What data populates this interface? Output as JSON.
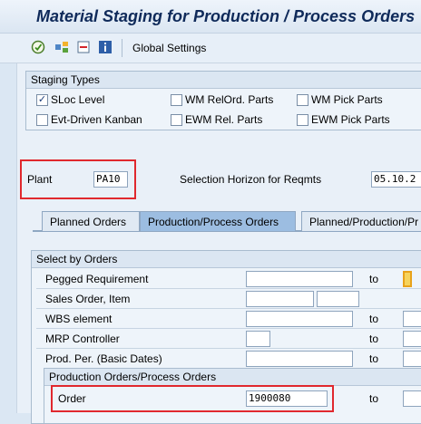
{
  "window": {
    "title": "Material Staging for Production / Process Orders"
  },
  "toolbar": {
    "icons": [
      "execute-icon",
      "variant-icon",
      "delete-icon",
      "info-icon"
    ],
    "global_settings_label": "Global Settings"
  },
  "staging_types": {
    "title": "Staging Types",
    "items": [
      {
        "label": "SLoc Level",
        "checked": true
      },
      {
        "label": "Evt-Driven Kanban",
        "checked": false
      },
      {
        "label": "WM RelOrd. Parts",
        "checked": false
      },
      {
        "label": "EWM Rel. Parts",
        "checked": false
      },
      {
        "label": "WM Pick Parts",
        "checked": false
      },
      {
        "label": "EWM Pick Parts",
        "checked": false
      }
    ]
  },
  "plant": {
    "label": "Plant",
    "value": "PA10"
  },
  "selection_horizon": {
    "label": "Selection Horizon for Reqmts",
    "value": "05.10.2"
  },
  "tabs": [
    "Planned Orders",
    "Production/Process Orders",
    "Planned/Production/Pr"
  ],
  "select_by_orders": {
    "title": "Select by Orders",
    "rows": [
      {
        "label": "Pegged Requirement",
        "to": "to"
      },
      {
        "label": "Sales Order, Item",
        "to": ""
      },
      {
        "label": "WBS element",
        "to": "to"
      },
      {
        "label": "MRP Controller",
        "to": "to"
      },
      {
        "label": "Prod. Per. (Basic Dates)",
        "to": "to"
      }
    ]
  },
  "production_orders": {
    "title": "Production Orders/Process Orders",
    "order_label": "Order",
    "order_value": "1900080",
    "to": "to"
  }
}
